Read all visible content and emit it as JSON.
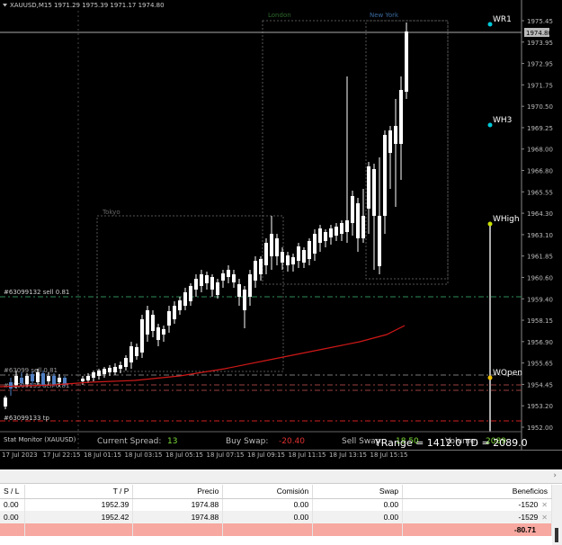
{
  "chart": {
    "symbol_header": "XAUUSD,M15  1971.29 1975.39 1971.17 1974.80",
    "last_price_tag": "1974.80",
    "price_axis": [
      "1975.45",
      "1973.95",
      "1972.95",
      "1971.75",
      "1970.50",
      "1969.25",
      "1968.00",
      "1966.80",
      "1965.55",
      "1964.30",
      "1963.10",
      "1961.85",
      "1960.60",
      "1959.40",
      "1958.15",
      "1956.90",
      "1955.65",
      "1954.45",
      "1953.20",
      "1952.00"
    ],
    "sessions": {
      "tokyo": "Tokyo",
      "london": "London",
      "new_york": "New York"
    },
    "levels": {
      "wr1": "WR1",
      "wh3": "WH3",
      "whigh": "WHigh",
      "wopen": "WOpen"
    },
    "order_lines": {
      "sell_line": "#63099132 sell 0.81",
      "line_2": "#63099 sell 0.81",
      "line_3": "#63099133 sell 0.81",
      "tp_line": "#63099133 tp"
    },
    "stats": {
      "monitor_label": "Stat Monitor (XAUUSD)",
      "spread_label": "Current Spread:",
      "spread_value": "13",
      "buy_swap_label": "Buy Swap:",
      "buy_swap_value": "-20.40",
      "sell_swap_label": "Sell Swap:",
      "sell_swap_value": "18.50",
      "volume_label": "Volume:",
      "volume_value": "2089",
      "range_text": "YRange = 1412.0  TD = 2089.0"
    },
    "time_axis": [
      "17 Jul 2023",
      "17 Jul 22:15",
      "18 Jul 01:15",
      "18 Jul 03:15",
      "18 Jul 05:15",
      "18 Jul 07:15",
      "18 Jul 09:15",
      "18 Jul 11:15",
      "18 Jul 13:15",
      "18 Jul 15:15"
    ],
    "colors": {
      "bull": "#4f7fc2",
      "bear": "#ffffff",
      "ma": "#d01818",
      "level_dot": "#00c8d8",
      "whigh_dot": "#c8e000",
      "wopen_dot": "#f0c000"
    }
  },
  "table": {
    "headers": {
      "sl": "S / L",
      "tp": "T / P",
      "price": "Precio",
      "commission": "Comisión",
      "swap": "Swap",
      "profit": "Beneficios"
    },
    "rows": [
      {
        "sl": "0.00",
        "tp": "1952.39",
        "price": "1974.88",
        "commission": "0.00",
        "swap": "0.00",
        "profit": "-1520"
      },
      {
        "sl": "0.00",
        "tp": "1952.42",
        "price": "1974.88",
        "commission": "0.00",
        "swap": "0.00",
        "profit": "-1529"
      }
    ],
    "total": "-80.71"
  }
}
